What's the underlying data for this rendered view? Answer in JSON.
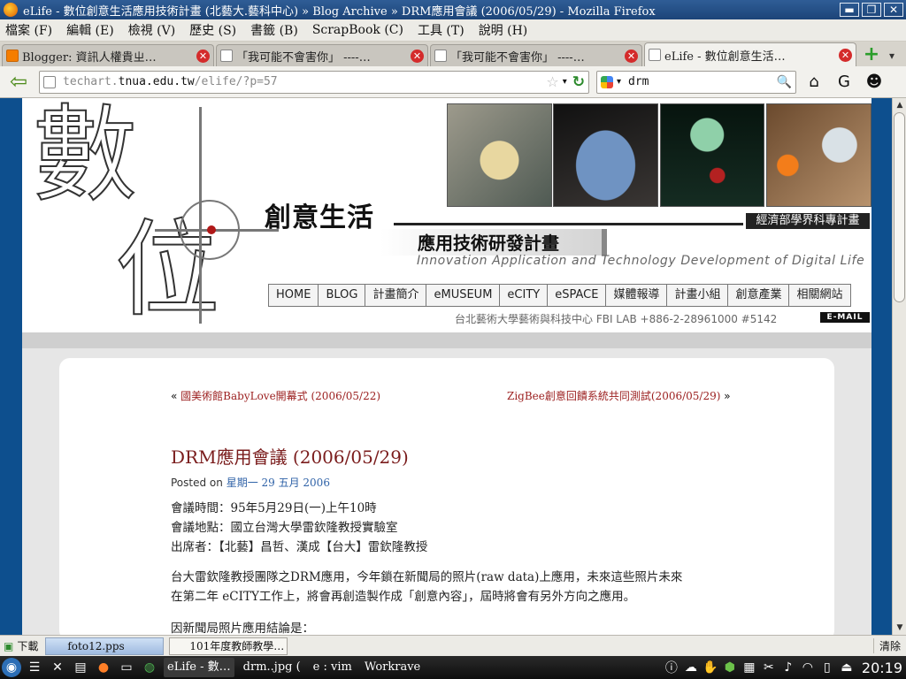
{
  "window": {
    "title": "eLife - 數位創意生活應用技術計畫 (北藝大.藝科中心) » Blog Archive » DRM應用會議 (2006/05/29) - Mozilla Firefox",
    "minimize": "▬",
    "maximize": "❐",
    "close": "✕"
  },
  "menu": [
    "檔案 (F)",
    "編輯 (E)",
    "檢視 (V)",
    "歷史 (S)",
    "書籤 (B)",
    "ScrapBook (C)",
    "工具 (T)",
    "說明 (H)"
  ],
  "tabs": [
    {
      "label": "Blogger: 資訊人權貴ㄓ…",
      "icon": "blogger-icon"
    },
    {
      "label": "「我可能不會害你」 ----…",
      "icon": "page-icon"
    },
    {
      "label": "「我可能不會害你」 ----…",
      "icon": "page-icon"
    },
    {
      "label": "eLife - 數位創意生活…",
      "icon": "page-icon"
    }
  ],
  "tab_close": "✕",
  "new_tab": "+",
  "tab_list": "▾",
  "nav": {
    "back": "⇦",
    "url_prefix": "techart.",
    "url_host": "tnua.edu.tw",
    "url_path": "/elife/?p=57",
    "bookmark_star": "☆",
    "url_dropdown": "▾",
    "reload": "↻",
    "search_value": "drm",
    "search_dropdown": "▾",
    "search_go": "🔍",
    "home": "⌂",
    "gmail": "G",
    "addon": "☻"
  },
  "site": {
    "logo_char_1": "數",
    "logo_char_2": "位",
    "slogan": "創意生活",
    "ministry_badge": "經濟部學界科專計畫",
    "subtitle": "應用技術研發計畫",
    "english_tagline": "Innovation Application  and  Technology Development  of  Digital Life",
    "nav_items": [
      "HOME",
      "BLOG",
      "計畫簡介",
      "eMUSEUM",
      "eCITY",
      "eSPACE",
      "媒體報導",
      "計畫小組",
      "創意產業",
      "相關網站"
    ],
    "contact": "台北藝術大學藝術與科技中心   FBI LAB   +886-2-28961000 #5142",
    "email_badge": "E-MAIL"
  },
  "post": {
    "prev_arrow": "«",
    "prev_link": "國美術館BabyLove開幕式 (2006/05/22)",
    "next_link": "ZigBee創意回饋系統共同測試(2006/05/29)",
    "next_arrow": "»",
    "title": "DRM應用會議 (2006/05/29)",
    "posted_label": "Posted on",
    "posted_date": "星期一 29 五月 2006",
    "lines": [
      "會議時間：95年5月29日(一)上午10時",
      "會議地點：國立台灣大學雷欽隆教授實驗室",
      "出席者：【北藝】昌哲、漢成【台大】雷欽隆教授",
      "台大雷欽隆教授團隊之DRM應用，今年鎖在新聞局的照片(raw data)上應用，未來這些照片未來",
      "在第二年 eCITY工作上，將會再創造製作成「創意內容」，屆時將會有另外方向之應用。",
      "因新聞局照片應用結論是："
    ]
  },
  "statusbar": {
    "download_label": "下載",
    "tasks": [
      "foto12.pps",
      "101年度教師教學…"
    ],
    "clear": "清除"
  },
  "taskbar": {
    "windows": [
      "eLife - 數…",
      "drm..jpg (",
      "e : vim",
      "Workrave"
    ],
    "clock": "20:19"
  }
}
